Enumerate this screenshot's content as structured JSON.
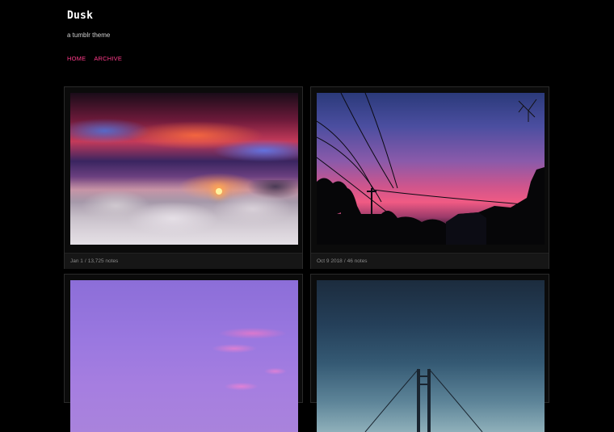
{
  "blog": {
    "title": "Dusk",
    "description": "a tumblr theme"
  },
  "nav": {
    "items": [
      "HOME",
      "ARCHIVE"
    ]
  },
  "posts": [
    {
      "date": "Jan 1",
      "notes": "13,725 notes"
    },
    {
      "date": "Oct 9 2018",
      "notes": "46 notes"
    },
    {
      "date": "",
      "notes": ""
    },
    {
      "date": "",
      "notes": ""
    }
  ],
  "colors": {
    "background": "#000000",
    "accent": "#ff3a8a",
    "meta_text": "#8a8a8a"
  }
}
